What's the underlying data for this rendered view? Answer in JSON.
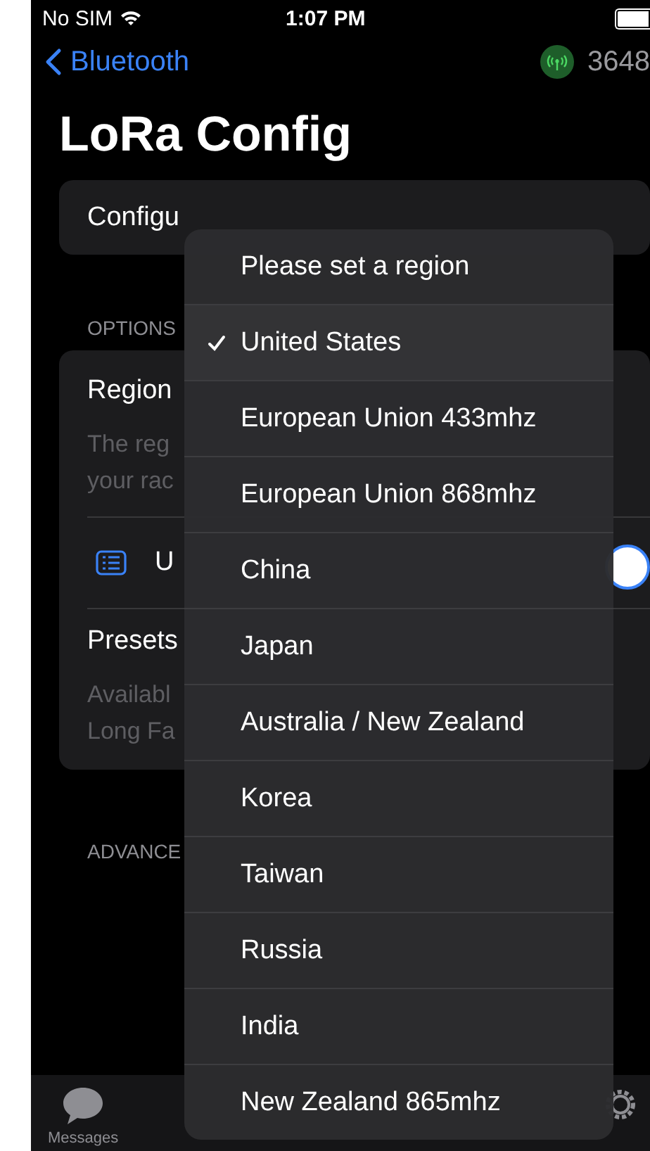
{
  "status_bar": {
    "carrier": "No SIM",
    "time": "1:07 PM"
  },
  "nav": {
    "back": "Bluetooth",
    "node_id": "3648"
  },
  "title": "LoRa Config",
  "config_row": "Configu",
  "options_header": "OPTIONS",
  "region_card": {
    "label": "Region",
    "description": [
      "The reg",
      "your rac"
    ],
    "row_value": "U",
    "presets_label": "Presets",
    "presets_description": [
      "Availabl",
      "Long Fa"
    ]
  },
  "advanced_header": "ADVANCE",
  "region_menu": [
    {
      "label": "Please set a region",
      "selected": false
    },
    {
      "label": "United States",
      "selected": true
    },
    {
      "label": "European Union 433mhz",
      "selected": false
    },
    {
      "label": "European Union 868mhz",
      "selected": false
    },
    {
      "label": "China",
      "selected": false
    },
    {
      "label": "Japan",
      "selected": false
    },
    {
      "label": "Australia / New Zealand",
      "selected": false
    },
    {
      "label": "Korea",
      "selected": false
    },
    {
      "label": "Taiwan",
      "selected": false
    },
    {
      "label": "Russia",
      "selected": false
    },
    {
      "label": "India",
      "selected": false
    },
    {
      "label": "New Zealand 865mhz",
      "selected": false
    }
  ],
  "tab_bar": [
    {
      "label": "Messages",
      "selected": false
    }
  ]
}
